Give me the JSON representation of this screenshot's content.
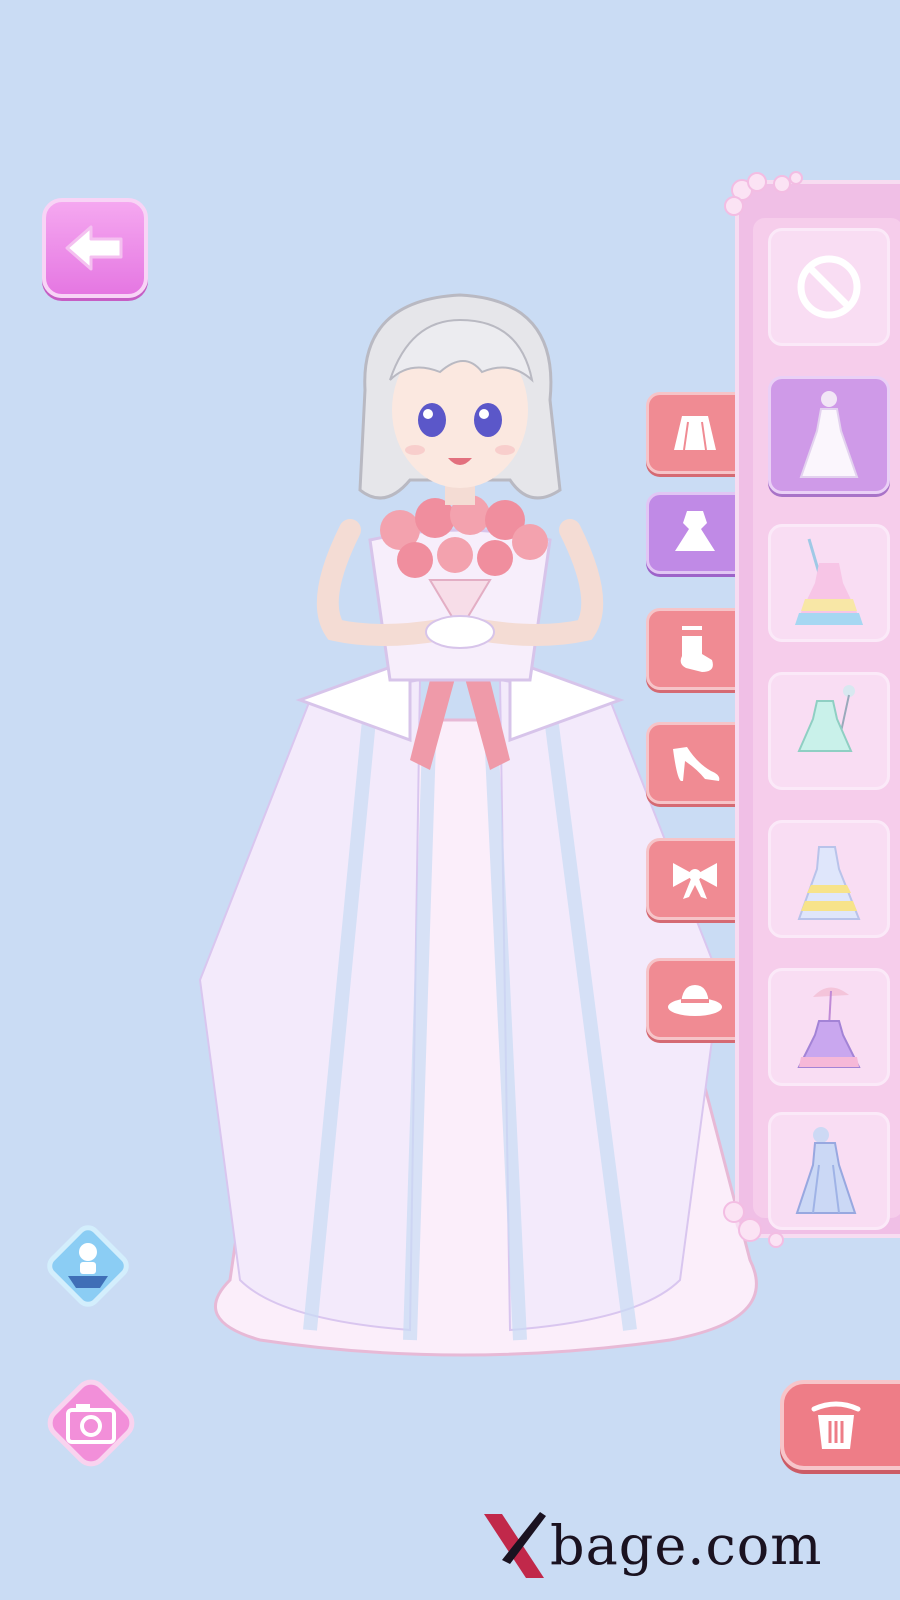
{
  "colors": {
    "background": "#cadcf4",
    "accent_pink": "#f08b93",
    "accent_purple": "#c08ae6",
    "panel": "#f0bfe6"
  },
  "back_button": {
    "icon": "arrow-left-icon"
  },
  "category_tabs": [
    {
      "id": "skirt",
      "icon": "skirt-icon",
      "active": false
    },
    {
      "id": "dress",
      "icon": "dress-icon",
      "active": true
    },
    {
      "id": "socks",
      "icon": "sock-icon",
      "active": false
    },
    {
      "id": "shoes",
      "icon": "high-heel-icon",
      "active": false
    },
    {
      "id": "bow",
      "icon": "bow-icon",
      "active": false
    },
    {
      "id": "hat",
      "icon": "hat-icon",
      "active": false
    }
  ],
  "item_slots": [
    {
      "id": "none",
      "icon": "no-item-icon",
      "selected": false
    },
    {
      "id": "wedding-gown",
      "icon": "white-gown-icon",
      "selected": true
    },
    {
      "id": "rainbow-gown",
      "icon": "rainbow-gown-icon",
      "selected": false
    },
    {
      "id": "mint-dress",
      "icon": "mint-dress-icon",
      "selected": false
    },
    {
      "id": "gold-gown",
      "icon": "gold-gown-icon",
      "selected": false
    },
    {
      "id": "parasol-dress",
      "icon": "parasol-dress-icon",
      "selected": false
    },
    {
      "id": "blue-gown",
      "icon": "blue-gown-icon",
      "selected": false
    }
  ],
  "pose_button": {
    "icon": "character-stand-icon"
  },
  "camera_button": {
    "icon": "camera-icon"
  },
  "trash_button": {
    "icon": "trash-icon"
  },
  "watermark": {
    "text": "bage.com"
  }
}
